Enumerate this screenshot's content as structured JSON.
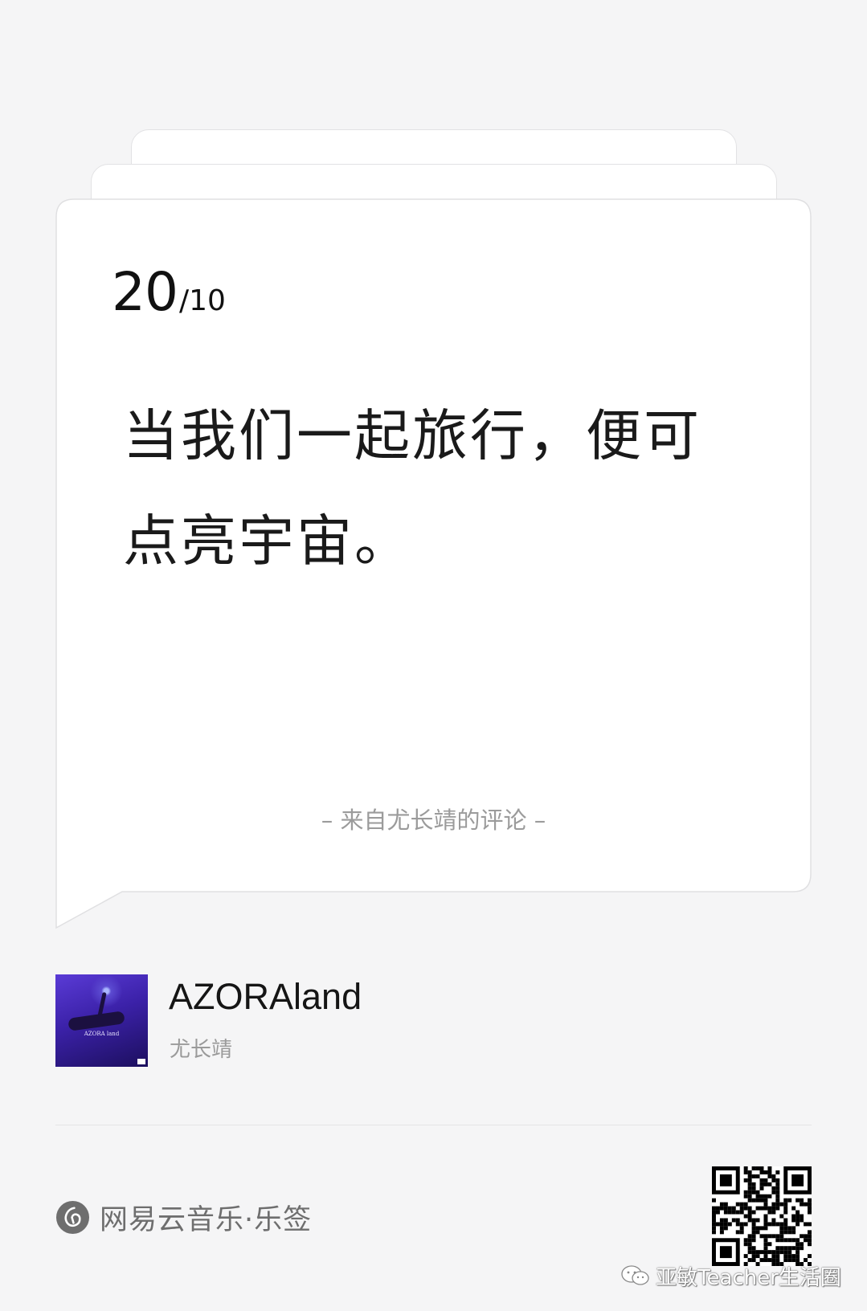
{
  "card": {
    "date_day": "20",
    "date_month": "/10",
    "quote_line1": "当我们一起旅行，便可",
    "quote_line2": "点亮宇宙。",
    "source": "– 来自尤长靖的评论 –"
  },
  "song": {
    "title": "AZORAland",
    "artist": "尤长靖",
    "cover_text": "AZORA land"
  },
  "footer": {
    "brand": "网易云音乐·乐签",
    "watermark": "亚敏Teacher生活圈"
  },
  "colors": {
    "background": "#f5f5f6",
    "card": "#ffffff",
    "text_primary": "#111111",
    "text_secondary": "#9b9b9b",
    "brand_gray": "#6e6e6e",
    "cover_purple": "#4a2cc4"
  },
  "icons": {
    "brand_logo": "netease-cloud-music-icon",
    "qr": "qr-code-icon",
    "watermark": "wechat-icon"
  }
}
